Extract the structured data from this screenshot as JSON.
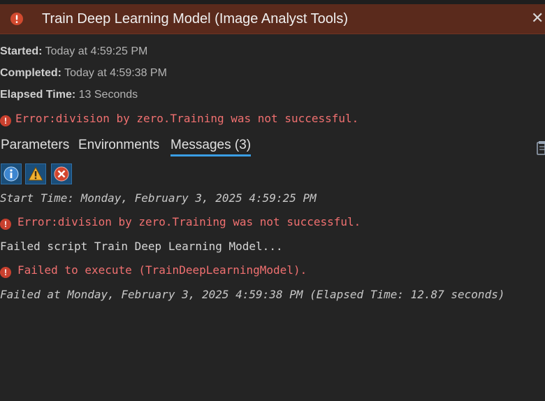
{
  "header": {
    "title": "Train Deep Learning Model (Image Analyst Tools)",
    "close_glyph": "✕",
    "status_icon": "error-icon"
  },
  "info": {
    "started_label": "Started:",
    "started_value": "Today at 4:59:25 PM",
    "completed_label": "Completed:",
    "completed_value": "Today at 4:59:38 PM",
    "elapsed_label": "Elapsed Time:",
    "elapsed_value": "13 Seconds"
  },
  "summary_error": "Error:division by zero.Training was not successful.",
  "tabs": [
    {
      "label": "Parameters",
      "active": false
    },
    {
      "label": "Environments",
      "active": false
    },
    {
      "label": "Messages (3)",
      "active": true
    }
  ],
  "filters": [
    "info-icon",
    "warning-icon",
    "error-filter-icon"
  ],
  "messages": [
    {
      "text": "Start Time: Monday, February 3, 2025 4:59:25 PM",
      "style": "italic"
    },
    {
      "text": "Error:division by zero.Training was not successful.",
      "style": "error"
    },
    {
      "text": "Failed script Train Deep Learning Model...",
      "style": "normal"
    },
    {
      "text": "Failed to execute (TrainDeepLearningModel).",
      "style": "error"
    },
    {
      "text": "Failed at Monday, February 3, 2025 4:59:38 PM (Elapsed Time: 12.87 seconds)",
      "style": "italic"
    }
  ],
  "colors": {
    "background": "#242424",
    "header": "#5a2a1c",
    "error_text": "#f07070",
    "accent": "#3a9ee4"
  }
}
